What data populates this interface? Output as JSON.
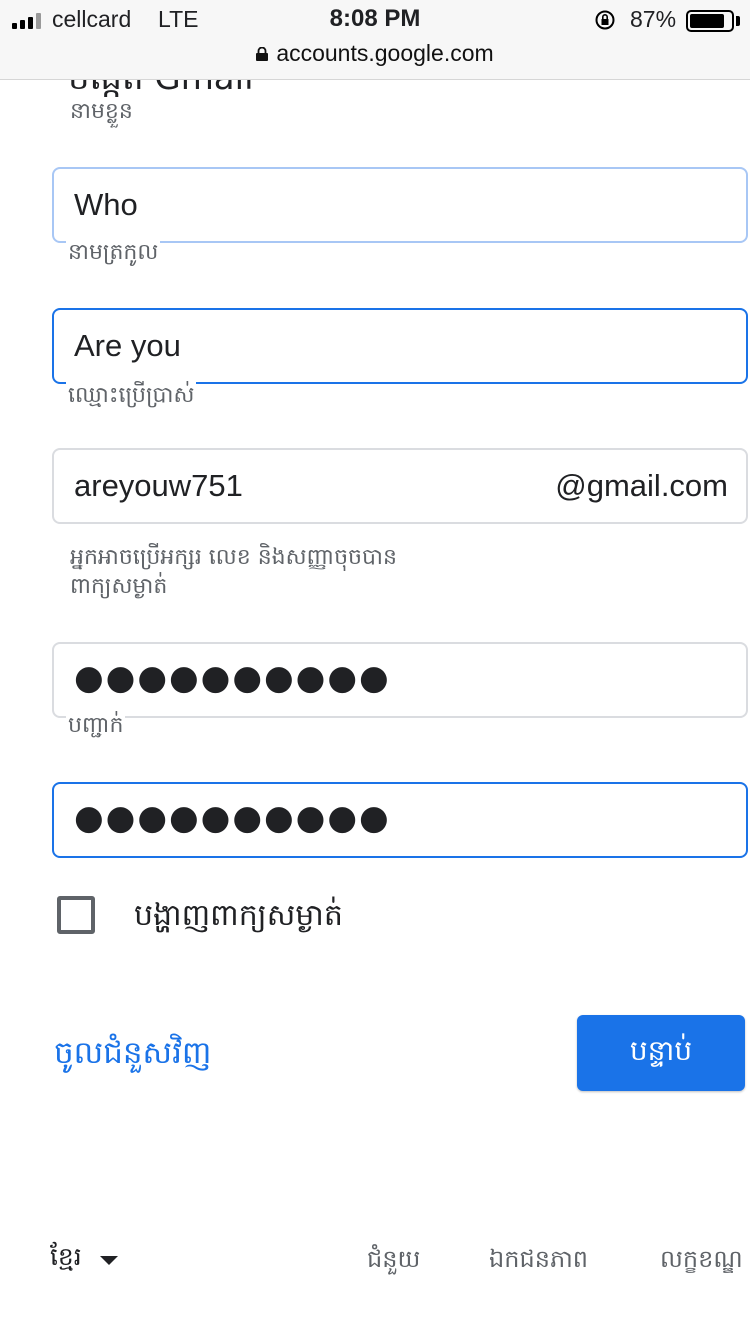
{
  "status_bar": {
    "carrier": "cellcard",
    "network": "LTE",
    "time": "8:08 PM",
    "battery": "87%",
    "battery_level": 0.87
  },
  "url_bar": {
    "domain": "accounts.google.com"
  },
  "form": {
    "heading_partial": "បង្កើត Gmail",
    "first_name": {
      "label": "នាមខ្លួន",
      "value": "Who"
    },
    "last_name": {
      "label": "នាមត្រកូល",
      "value": "Are you"
    },
    "username": {
      "label": "ឈ្មោះប្រើប្រាស់",
      "value": "areyouw751",
      "suffix": "@gmail.com",
      "hint": "អ្នកអាចប្រើអក្សរ លេខ និងសញ្ញាចុចបាន"
    },
    "password": {
      "label": "ពាក្យសម្ងាត់",
      "value": "●●●●●●●●●●"
    },
    "confirm": {
      "label": "បញ្ជាក់",
      "value": "●●●●●●●●●●"
    },
    "show_password": {
      "label": "បង្ហាញពាក្យសម្ងាត់",
      "checked": false
    }
  },
  "actions": {
    "signin_instead": "ចូលជំនួសវិញ",
    "next": "បន្ទាប់"
  },
  "footer": {
    "language": "ខ្មែរ",
    "help": "ជំនួយ",
    "privacy": "ឯកជនភាព",
    "terms": "លក្ខខណ្ឌ"
  },
  "colors": {
    "accent": "#1a73e8",
    "label_gray": "#5f6368",
    "border_gray": "#dadce0"
  }
}
